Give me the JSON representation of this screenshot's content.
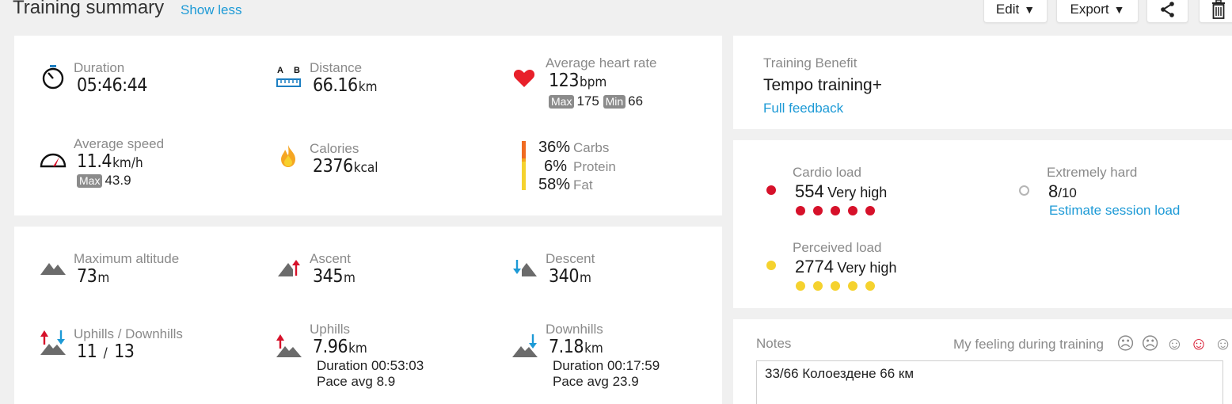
{
  "header": {
    "title": "Training summary",
    "toggle_label": "Show less",
    "edit_label": "Edit",
    "export_label": "Export",
    "dropdown_glyph": "▼"
  },
  "summary": {
    "duration": {
      "label": "Duration",
      "value": "05:46:44"
    },
    "distance": {
      "label": "Distance",
      "value": "66.16",
      "unit": "km",
      "icon_text_a": "A",
      "icon_text_b": "B"
    },
    "heart_rate": {
      "label": "Average heart rate",
      "value": "123",
      "unit": "bpm",
      "max_label": "Max",
      "max_value": "175",
      "min_label": "Min",
      "min_value": "66"
    },
    "speed": {
      "label": "Average speed",
      "value": "11.4",
      "unit": "km/h",
      "max_label": "Max",
      "max_value": "43.9"
    },
    "calories": {
      "label": "Calories",
      "value": "2376",
      "unit": "kcal"
    },
    "nutrition": [
      {
        "pct": "36%",
        "label": "Carbs"
      },
      {
        "pct": "6%",
        "label": "Protein"
      },
      {
        "pct": "58%",
        "label": "Fat"
      }
    ]
  },
  "altitude": {
    "max_altitude": {
      "label": "Maximum altitude",
      "value": "73",
      "unit": "m"
    },
    "ascent": {
      "label": "Ascent",
      "value": "345",
      "unit": "m"
    },
    "descent": {
      "label": "Descent",
      "value": "340",
      "unit": "m"
    },
    "uphills_downhills": {
      "label": "Uphills / Downhills",
      "uphills": "11",
      "separator": "/",
      "downhills": "13"
    },
    "uphills": {
      "label": "Uphills",
      "value": "7.96",
      "unit": "km",
      "duration": "Duration 00:53:03",
      "pace": "Pace avg 8.9"
    },
    "downhills": {
      "label": "Downhills",
      "value": "7.18",
      "unit": "km",
      "duration": "Duration 00:17:59",
      "pace": "Pace avg 23.9"
    }
  },
  "benefit": {
    "label": "Training Benefit",
    "value": "Tempo training+",
    "link": "Full feedback"
  },
  "load": {
    "cardio": {
      "label": "Cardio load",
      "value": "554",
      "level": "Very high",
      "dots": 5,
      "color": "#d6112a"
    },
    "perceived": {
      "label": "Perceived load",
      "value": "2774",
      "level": "Very high",
      "dots": 5,
      "color": "#f5d22e"
    },
    "exertion": {
      "label": "Extremely hard",
      "value": "8",
      "scale": "/10",
      "link": "Estimate session load"
    }
  },
  "notes": {
    "label": "Notes",
    "feeling_label": "My feeling during training",
    "faces": [
      "☹",
      "☹",
      "☺",
      "☺",
      "☺"
    ],
    "selected_face_index": 3,
    "text": "33/66 Колоездене 66 км"
  },
  "colors": {
    "accent": "#1d9ad6",
    "cardio": "#d6112a",
    "perceived": "#f5d22e",
    "heart": "#e8202a",
    "flame": "#f5a623"
  }
}
